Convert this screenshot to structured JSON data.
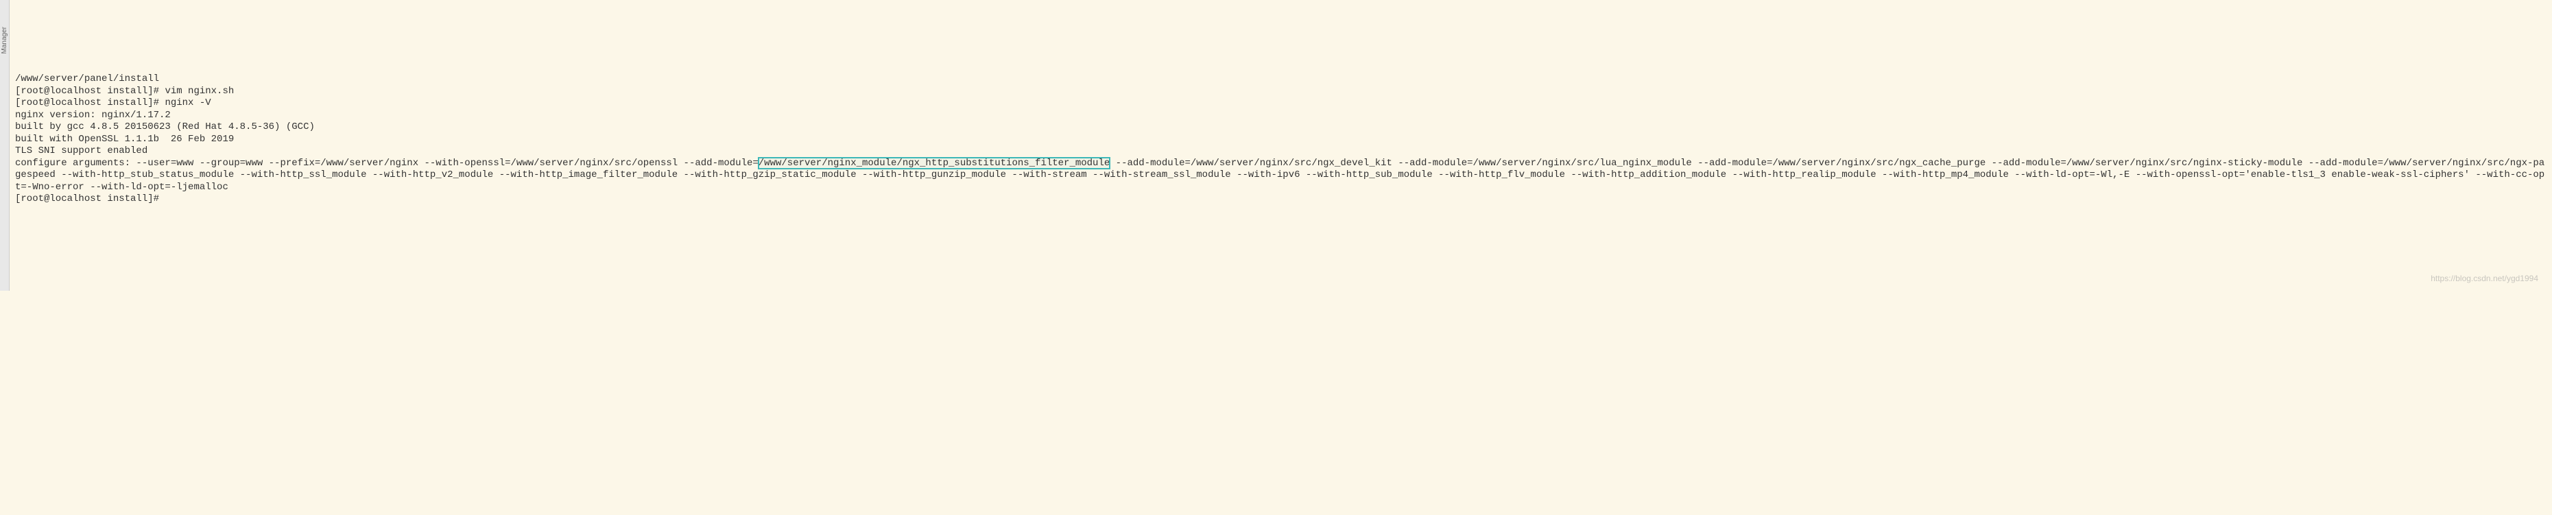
{
  "sidebar": {
    "label": "Manager"
  },
  "terminal": {
    "line1": "/www/server/panel/install",
    "prompt1": "[root@localhost install]# ",
    "cmd1": "vim nginx.sh",
    "prompt2": "[root@localhost install]# ",
    "cmd2": "nginx -V",
    "version": "nginx version: nginx/1.17.2",
    "built_by": "built by gcc 4.8.5 20150623 (Red Hat 4.8.5-36) (GCC)",
    "built_with": "built with OpenSSL 1.1.1b  26 Feb 2019",
    "tls_sni": "TLS SNI support enabled",
    "cfg_pre": "configure arguments: --user=www --group=www --prefix=/www/server/nginx --with-openssl=/www/server/nginx/src/openssl --add-module=",
    "cfg_highlight": "/www/server/nginx_module/ngx_http_substitutions_filter_module",
    "cfg_post": " --add-module=/www/server/nginx/src/ngx_devel_kit --add-module=/www/server/nginx/src/lua_nginx_module --add-module=/www/server/nginx/src/ngx_cache_purge --add-module=/www/server/nginx/src/nginx-sticky-module --add-module=/www/server/nginx/src/ngx-pagespeed --with-http_stub_status_module --with-http_ssl_module --with-http_v2_module --with-http_image_filter_module --with-http_gzip_static_module --with-http_gunzip_module --with-stream --with-stream_ssl_module --with-ipv6 --with-http_sub_module --with-http_flv_module --with-http_addition_module --with-http_realip_module --with-http_mp4_module --with-ld-opt=-Wl,-E --with-openssl-opt='enable-tls1_3 enable-weak-ssl-ciphers' --with-cc-opt=-Wno-error --with-ld-opt=-ljemalloc",
    "prompt3": "[root@localhost install]#"
  },
  "watermark": "https://blog.csdn.net/ygd1994"
}
